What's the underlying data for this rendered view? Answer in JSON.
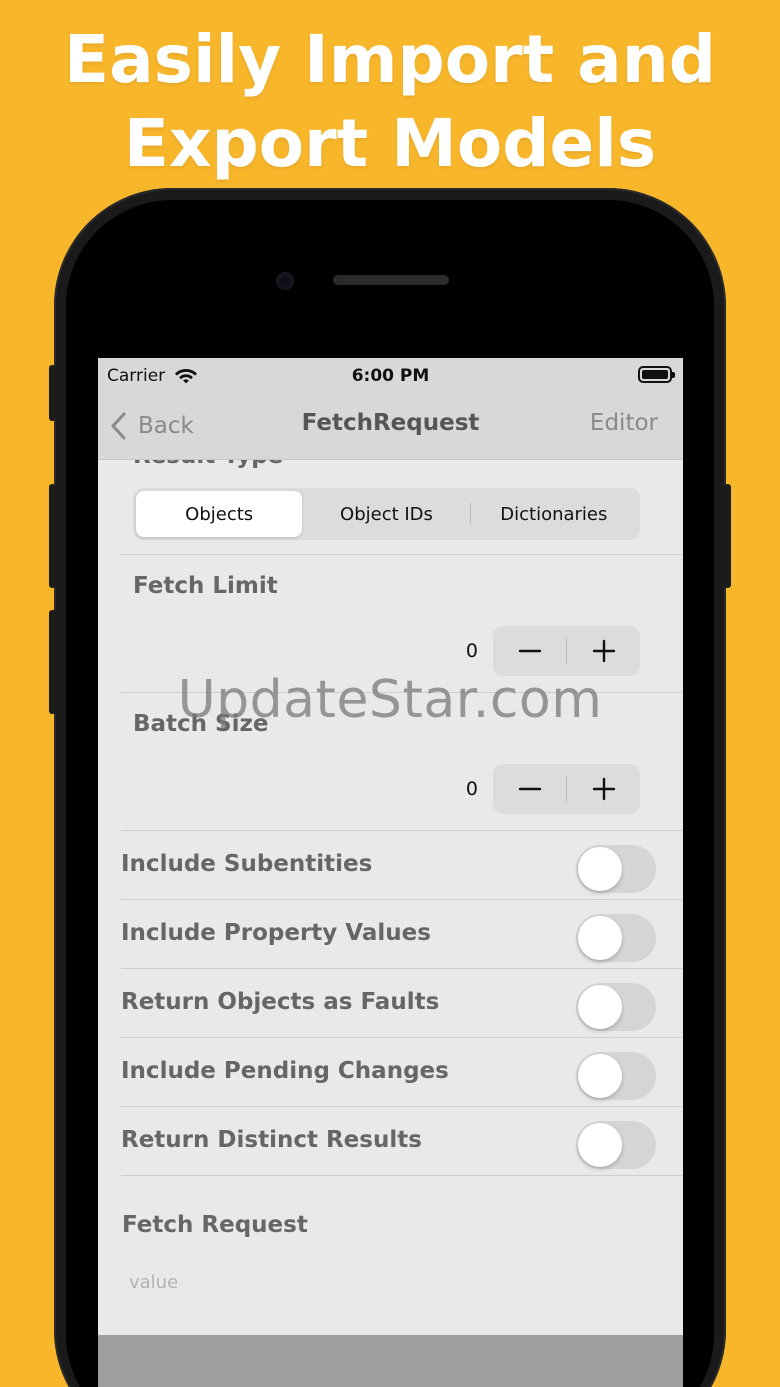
{
  "headline": {
    "line1": "Easily Import and",
    "line2": "Export Models"
  },
  "status_bar": {
    "carrier": "Carrier",
    "time": "6:00 PM"
  },
  "nav": {
    "back_label": "Back",
    "title": "FetchRequest",
    "right_label": "Editor"
  },
  "result_type": {
    "label": "Result Type",
    "segments": [
      "Objects",
      "Object IDs",
      "Dictionaries"
    ],
    "selected": "Objects"
  },
  "fetch_limit": {
    "label": "Fetch Limit",
    "value": "0"
  },
  "batch_size": {
    "label": "Batch Size",
    "value": "0"
  },
  "toggles": [
    {
      "label": "Include Subentities",
      "on": false
    },
    {
      "label": "Include Property Values",
      "on": false
    },
    {
      "label": "Return Objects as Faults",
      "on": false
    },
    {
      "label": "Include Pending Changes",
      "on": false
    },
    {
      "label": "Return Distinct Results",
      "on": false
    }
  ],
  "fetch_request": {
    "label": "Fetch Request",
    "placeholder": "value"
  },
  "watermark": "UpdateStar.com",
  "colors": {
    "background": "#F8B62B",
    "screen": "#E9E9E9",
    "bars": "#D8D8D8"
  },
  "icons": [
    "wifi-icon",
    "battery-icon",
    "back-chevron-icon",
    "minus-icon",
    "plus-icon"
  ]
}
